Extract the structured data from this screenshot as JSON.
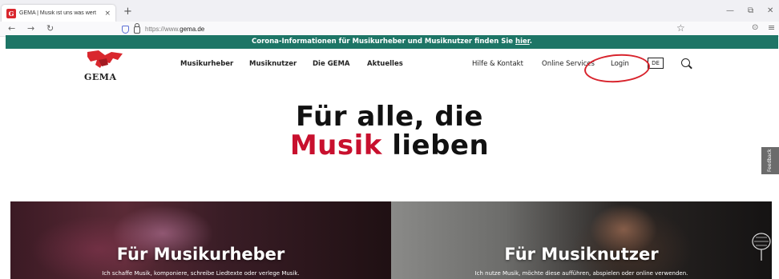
{
  "browser": {
    "tab_title": "GEMA | Musik ist uns was wert",
    "tab_close": "×",
    "new_tab": "+",
    "url_prefix": "https://www.",
    "url_domain": "gema.de",
    "back": "←",
    "forward": "→",
    "reload": "↻",
    "star": "☆",
    "minimize": "—",
    "restore": "⧉",
    "close": "✕",
    "pocket": "⊙",
    "menu": "≡"
  },
  "banner": {
    "text": "Corona-Informationen für Musikurheber und Musiknutzer finden Sie",
    "link": "hier",
    "suffix": "."
  },
  "header": {
    "logo_text": "GEMA",
    "main_nav": [
      "Musikurheber",
      "Musiknutzer",
      "Die GEMA",
      "Aktuelles"
    ],
    "meta_nav": [
      "Hilfe & Kontakt",
      "Online Services",
      "Login"
    ],
    "language": "DE",
    "annotation_color": "#d8242d"
  },
  "hero": {
    "line1": "Für alle, die",
    "line2_accent": "Musik",
    "line2_rest": " lieben",
    "accent_color": "#c8102e"
  },
  "feedback": {
    "label": "Feedback"
  },
  "cards": [
    {
      "title": "Für Musikurheber",
      "subtitle": "Ich schaffe Musik, komponiere, schreibe Liedtexte oder verlege Musik."
    },
    {
      "title": "Für Musiknutzer",
      "subtitle": "Ich nutze Musik, möchte diese aufführen, abspielen oder online verwenden."
    }
  ],
  "colors": {
    "banner_bg": "#1d7566",
    "brand_red": "#d9272e"
  }
}
